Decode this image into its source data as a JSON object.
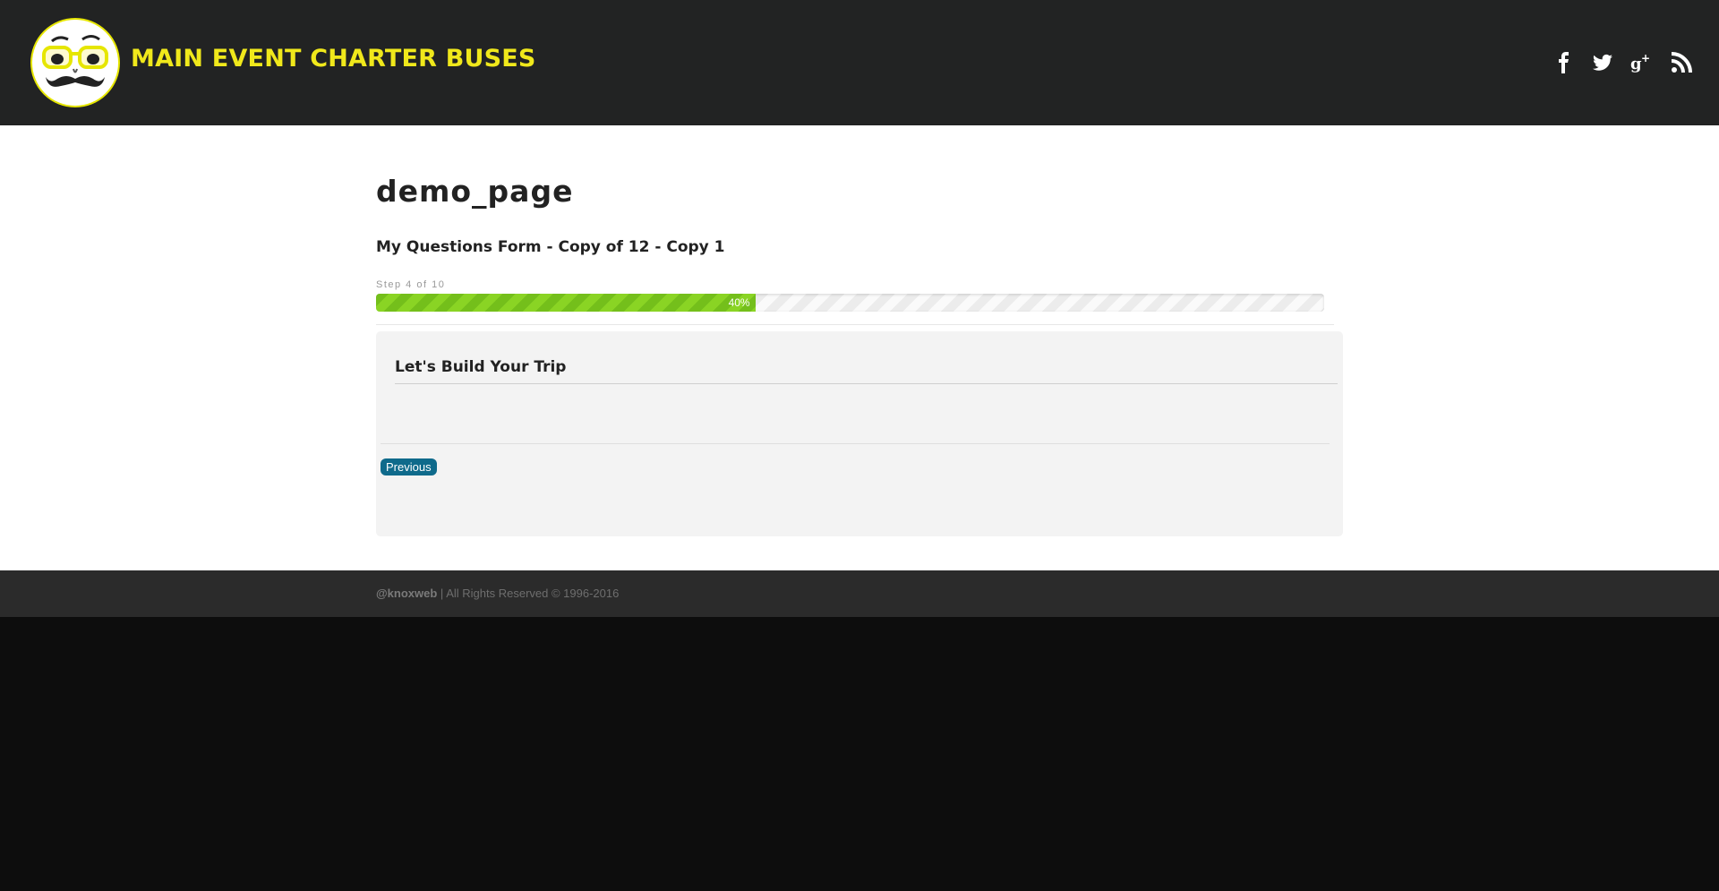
{
  "header": {
    "brand": "MAIN EVENT CHARTER BUSES",
    "social": [
      "facebook-icon",
      "twitter-icon",
      "google-plus-icon",
      "rss-icon"
    ]
  },
  "page": {
    "title": "demo_page",
    "form_title": "My Questions Form - Copy of 12 - Copy 1",
    "step_label": "Step 4 of 10",
    "progress_percent": 40,
    "progress_text": "40%"
  },
  "panel": {
    "heading": "Let's Build Your Trip",
    "previous_label": "Previous"
  },
  "footer": {
    "handle": "@knoxweb",
    "rights": " | All Rights Reserved © 1996-2016"
  },
  "colors": {
    "header_bg": "#222323",
    "brand": "#f0e81b",
    "progress": "#7dc71d",
    "button": "#0f6a8b"
  }
}
